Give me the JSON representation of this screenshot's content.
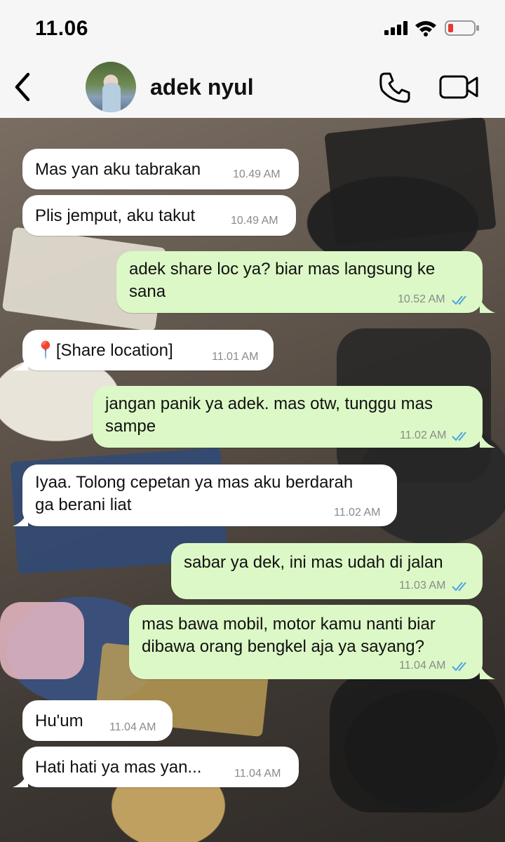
{
  "status_bar": {
    "time": "11.06",
    "icons": [
      "signal-icon",
      "wifi-icon",
      "battery-low-icon"
    ]
  },
  "header": {
    "contact_name": "adek nyul",
    "icons": [
      "back-chevron-icon",
      "contact-avatar",
      "phone-call-icon",
      "video-call-icon"
    ]
  },
  "messages": [
    {
      "direction": "in",
      "text": "Mas yan aku tabrakan",
      "time": "10.49 AM"
    },
    {
      "direction": "in",
      "text": "Plis jemput, aku takut",
      "time": "10.49 AM"
    },
    {
      "direction": "out",
      "lines": [
        "adek share loc ya? biar mas langsung ke",
        "sana"
      ],
      "time": "10.52 AM",
      "read": true
    },
    {
      "direction": "in",
      "text": "📍[Share location]",
      "time": "11.01 AM"
    },
    {
      "direction": "out",
      "lines": [
        "jangan panik ya adek. mas otw, tunggu mas",
        "sampe"
      ],
      "time": "11.02 AM",
      "read": true
    },
    {
      "direction": "in",
      "lines": [
        "Iyaa. Tolong cepetan ya mas aku berdarah",
        "ga berani liat"
      ],
      "time": "11.02 AM"
    },
    {
      "direction": "out",
      "text": "sabar ya dek, ini mas udah di jalan",
      "time": "11.03 AM",
      "read": true
    },
    {
      "direction": "out",
      "lines": [
        "mas bawa mobil, motor kamu nanti biar",
        "dibawa orang bengkel aja ya sayang?"
      ],
      "time": "11.04 AM",
      "read": true
    },
    {
      "direction": "in",
      "text": "Hu'um",
      "time": "11.04 AM"
    },
    {
      "direction": "in",
      "text": "Hati hati ya mas yan...",
      "time": "11.04 AM"
    }
  ],
  "colors": {
    "incoming_bubble": "#ffffff",
    "outgoing_bubble": "#dcf8c6",
    "read_ticks": "#4fa3e0",
    "battery_low": "#e53935"
  }
}
